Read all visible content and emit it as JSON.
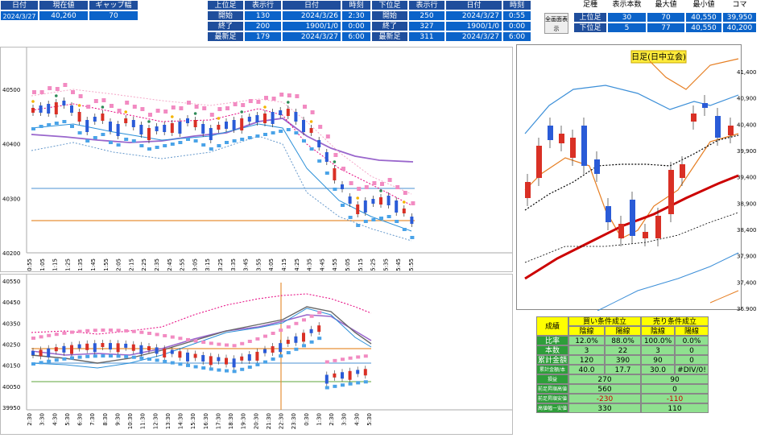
{
  "top_left": {
    "headers": [
      "日付",
      "現在値",
      "ギャップ幅"
    ],
    "values": [
      "2024/3/27",
      "40,260",
      "70"
    ]
  },
  "mid_table": {
    "headers": [
      "上位足",
      "表示行",
      "日付",
      "時刻",
      "下位足",
      "表示行",
      "日付",
      "時刻"
    ],
    "rows": [
      [
        "開始",
        "130",
        "2024/3/26",
        "2:30",
        "開始",
        "250",
        "2024/3/27",
        "0:55"
      ],
      [
        "終了",
        "200",
        "1900/1/0",
        "0:00",
        "終了",
        "327",
        "1900/1/0",
        "0:00"
      ],
      [
        "最新足",
        "179",
        "2024/3/27",
        "6:00",
        "最新足",
        "311",
        "2024/3/27",
        "6:00"
      ]
    ]
  },
  "fullscreen_button": "全画面表示",
  "right_table": {
    "headers": [
      "足種",
      "表示本数",
      "最大値",
      "最小値",
      "コマ"
    ],
    "rows": [
      [
        "上位足",
        "30",
        "70",
        "40,550",
        "39,950"
      ],
      [
        "下位足",
        "5",
        "77",
        "40,550",
        "40,200"
      ]
    ]
  },
  "chart1": {
    "yticks": [
      "40500",
      "40400",
      "40300",
      "40200"
    ],
    "xticks": [
      "0:55",
      "1:05",
      "1:15",
      "1:25",
      "1:35",
      "1:45",
      "1:55",
      "2:05",
      "2:15",
      "2:25",
      "2:35",
      "2:45",
      "2:55",
      "3:05",
      "3:15",
      "3:25",
      "3:35",
      "3:45",
      "3:55",
      "4:05",
      "4:15",
      "4:25",
      "4:35",
      "4:45",
      "4:55",
      "5:05",
      "5:15",
      "5:25",
      "5:35",
      "5:45",
      "5:55"
    ]
  },
  "chart2": {
    "yticks": [
      "40550",
      "40450",
      "40350",
      "40250",
      "40150",
      "40050",
      "39950"
    ],
    "xticks": [
      "2:30",
      "3:30",
      "4:30",
      "5:30",
      "6:30",
      "7:30",
      "8:30",
      "9:30",
      "10:30",
      "11:30",
      "12:30",
      "13:30",
      "14:30",
      "15:30",
      "16:30",
      "17:30",
      "18:30",
      "19:30",
      "20:30",
      "21:30",
      "22:30",
      "23:30",
      "0:30",
      "1:30",
      "2:30",
      "3:30",
      "4:30",
      "5:30"
    ]
  },
  "daily": {
    "title": "日足(日中立会)",
    "yticks": [
      "41,400",
      "40,900",
      "40,400",
      "39,900",
      "39,400",
      "38,900",
      "38,400",
      "37,900",
      "37,400",
      "36,900"
    ]
  },
  "perf": {
    "title": "成績",
    "buy": "買い条件成立",
    "sell": "売り条件成立",
    "sub": [
      "陰線",
      "陰線",
      "陰線",
      "陰線"
    ],
    "sub_labels": [
      "陰線",
      "陽線",
      "陰線",
      "陽線"
    ],
    "rows": [
      {
        "label": "比率",
        "vals": [
          "12.0%",
          "88.0%",
          "100.0%",
          "0.0%"
        ]
      },
      {
        "label": "本数",
        "vals": [
          "3",
          "22",
          "3",
          "0"
        ]
      },
      {
        "label": "累計金額",
        "vals": [
          "120",
          "390",
          "90",
          "0"
        ]
      },
      {
        "label": "累計金額/本",
        "vals": [
          "40.0",
          "17.7",
          "30.0",
          "#DIV/0!"
        ]
      }
    ],
    "rows2": [
      {
        "label": "損益",
        "buy": "270",
        "sell": "90"
      },
      {
        "label": "前足昇順高値幅",
        "buy": "560",
        "sell": "0"
      },
      {
        "label": "前足昇順安値幅",
        "buy": "-230",
        "sell": "-110"
      },
      {
        "label": "高値幅ー安値幅",
        "buy": "330",
        "sell": "110"
      }
    ]
  }
}
